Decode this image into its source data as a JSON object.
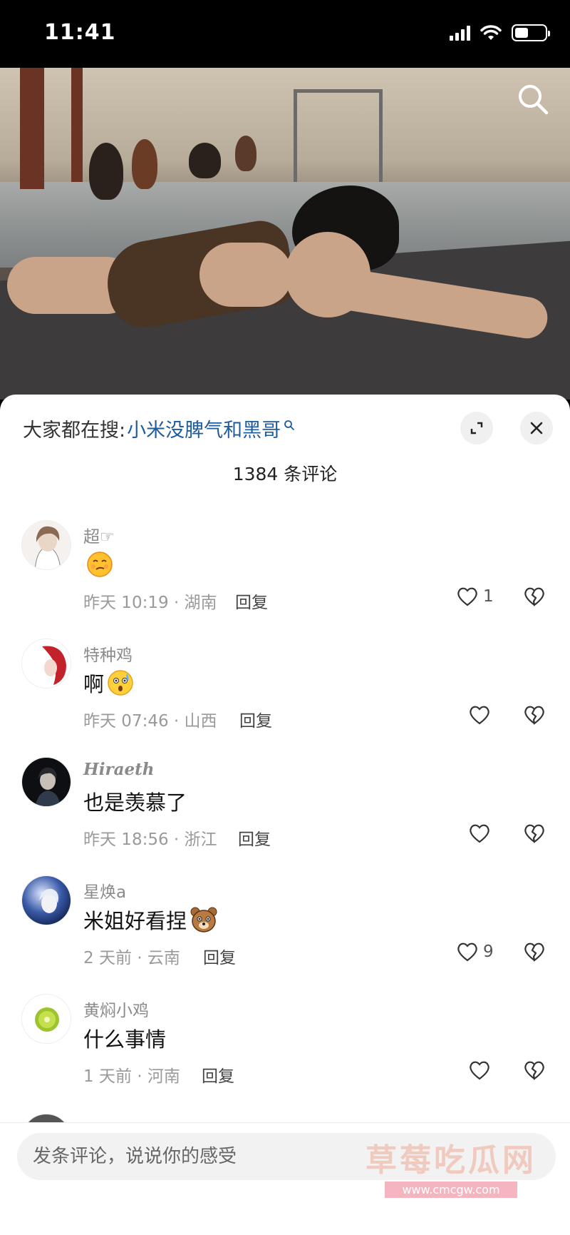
{
  "status_bar": {
    "time": "11:41"
  },
  "video": {
    "search_icon": "search-icon"
  },
  "sheet": {
    "trending_prefix": "大家都在搜:",
    "trending_keyword": "小米没脾气和黑哥",
    "comment_count_label": "1384 条评论",
    "comments": [
      {
        "user": "超☞",
        "text": "",
        "emoji": "smirk-emoji",
        "meta": "昨天 10:19 · 湖南",
        "reply": "回复",
        "likes": "1"
      },
      {
        "user": "特种鸡",
        "text": "啊",
        "emoji": "cold-sweat-emoji",
        "meta": "昨天 07:46 · 山西",
        "reply": "回复",
        "likes": ""
      },
      {
        "user": "Hiraeth",
        "text": "也是羡慕了",
        "emoji": "",
        "meta": "昨天 18:56 · 浙江",
        "reply": "回复",
        "likes": ""
      },
      {
        "user": "星焕a",
        "text": "米姐好看捏",
        "emoji": "bear-emoji",
        "meta": "2 天前 · 云南",
        "reply": "回复",
        "likes": "9"
      },
      {
        "user": "黄焖小鸡",
        "text": "什么事情",
        "emoji": "",
        "meta": "1 天前 · 河南",
        "reply": "回复",
        "likes": ""
      }
    ]
  },
  "input": {
    "placeholder": "发条评论，说说你的感受"
  },
  "watermark": {
    "title": "草莓吃瓜网",
    "url": "www.cmcgw.com"
  }
}
